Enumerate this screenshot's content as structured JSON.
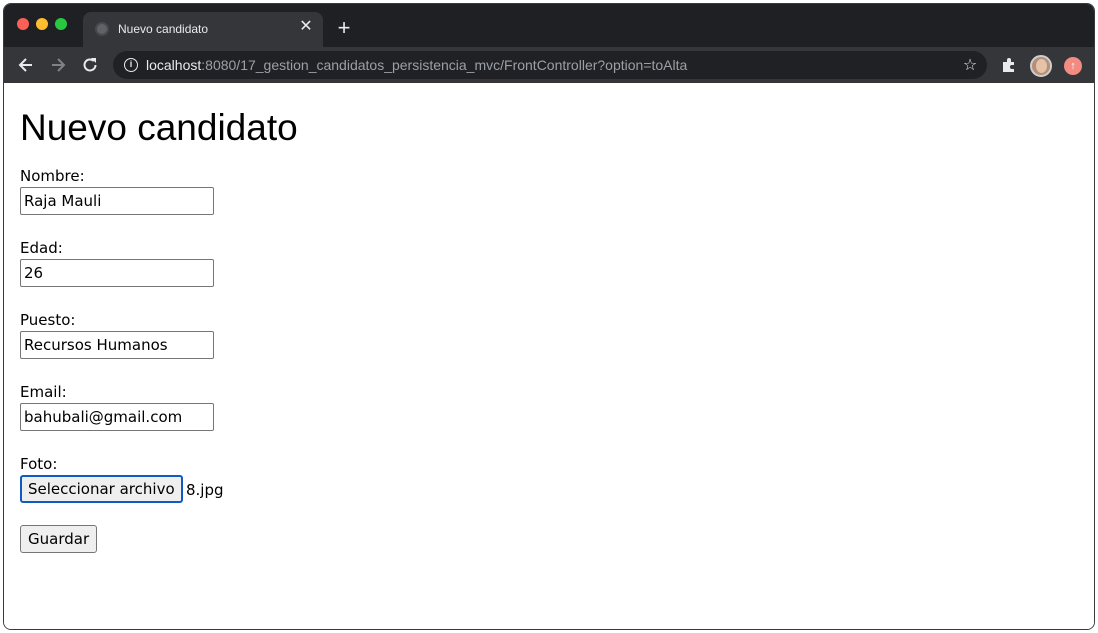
{
  "browser": {
    "tab_title": "Nuevo candidato",
    "url_host": "localhost",
    "url_rest": ":8080/17_gestion_candidatos_persistencia_mvc/FrontController?option=toAlta"
  },
  "page": {
    "title": "Nuevo candidato",
    "fields": [
      {
        "label": "Nombre:",
        "value": "Raja Mauli"
      },
      {
        "label": "Edad:",
        "value": "26"
      },
      {
        "label": "Puesto:",
        "value": "Recursos Humanos"
      },
      {
        "label": "Email:",
        "value": "bahubali@gmail.com"
      }
    ],
    "photo": {
      "label": "Foto:",
      "button_label": "Seleccionar archivo",
      "file_name": "8.jpg"
    },
    "save_label": "Guardar"
  }
}
